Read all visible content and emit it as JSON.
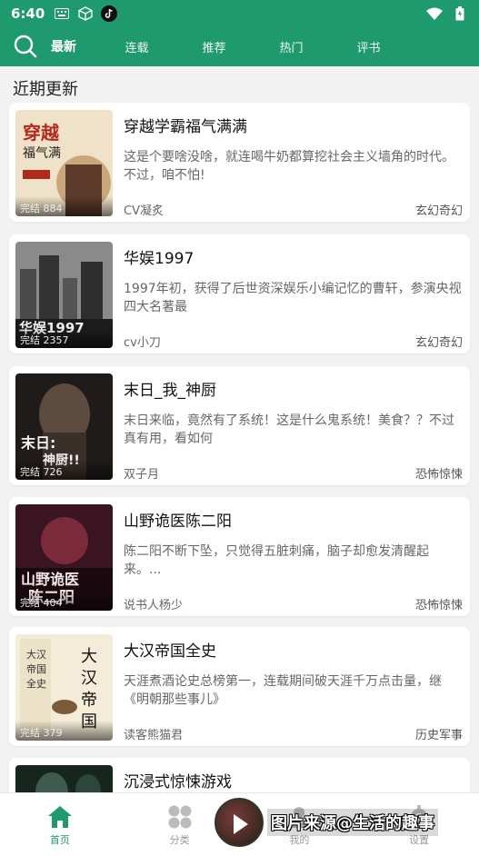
{
  "status_bar": {
    "time": "6:40",
    "icons": [
      "keyboard-icon",
      "cube-icon",
      "tiktok-icon",
      "wifi-icon",
      "battery-icon"
    ]
  },
  "nav": {
    "tabs": [
      {
        "label": "最新",
        "active": true
      },
      {
        "label": "连载",
        "active": false
      },
      {
        "label": "推荐",
        "active": false
      },
      {
        "label": "热门",
        "active": false
      },
      {
        "label": "评书",
        "active": false
      }
    ]
  },
  "section": {
    "title": "近期更新"
  },
  "books": [
    {
      "title": "穿越学霸福气满满",
      "desc": "这是个要啥没啥，就连喝牛奶都算挖社会主义墙角的时代。不过，咱不怕!",
      "author": "CV凝炙",
      "genre": "玄幻奇幻",
      "status": "完结",
      "count": "884"
    },
    {
      "title": "华娱1997",
      "desc": "1997年初，获得了后世资深娱乐小编记忆的曹轩，参演央视四大名著最",
      "author": "cv小刀",
      "genre": "玄幻奇幻",
      "status": "完结",
      "count": "2357"
    },
    {
      "title": "末日_我_神厨",
      "desc": "末日来临，竟然有了系统！这是什么鬼系统！美食？？不过真有用，看如何",
      "author": "双子月",
      "genre": "恐怖惊悚",
      "status": "完结",
      "count": "726"
    },
    {
      "title": "山野诡医陈二阳",
      "desc": " 陈二阳不断下坠，只觉得五脏刺痛，脑子却愈发清醒起来。...",
      "author": "说书人杨少",
      "genre": "恐怖惊悚",
      "status": "完结",
      "count": "404"
    },
    {
      "title": "大汉帝国全史",
      "desc": "天涯煮酒论史总榜第一，连载期间破天涯千万点击量，继《明朝那些事儿》",
      "author": "读客熊猫君",
      "genre": "历史军事",
      "status": "完结",
      "count": "379"
    },
    {
      "title": "沉浸式惊悚游戏",
      "desc": "",
      "author": "",
      "genre": "",
      "status": "",
      "count": ""
    }
  ],
  "tabbar": {
    "items": [
      {
        "label": "首页",
        "active": true
      },
      {
        "label": "分类",
        "active": false
      },
      {
        "label": "我的",
        "active": false
      },
      {
        "label": "设置",
        "active": false
      }
    ]
  },
  "watermark": {
    "text": "图片来源@生活的趣事"
  },
  "colors": {
    "brand": "#1f9a6f"
  }
}
